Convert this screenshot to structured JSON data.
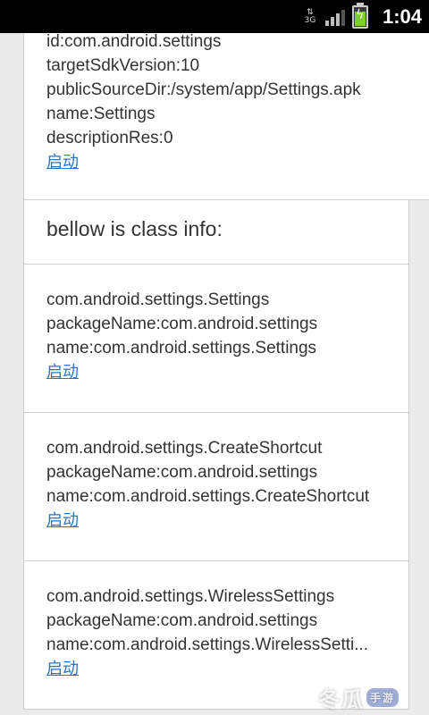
{
  "status_bar": {
    "network": "3G",
    "time": "1:04"
  },
  "app_info": {
    "lines": [
      "id:com.android.settings",
      "targetSdkVersion:10",
      "publicSourceDir:/system/app/Settings.apk",
      "name:Settings",
      "descriptionRes:0"
    ],
    "launch_label": "启动"
  },
  "class_header": "bellow is class info:",
  "classes": [
    {
      "class_name": "com.android.settings.Settings",
      "package_line": "packageName:com.android.settings",
      "name_line": "name:com.android.settings.Settings",
      "launch_label": "启动"
    },
    {
      "class_name": "com.android.settings.CreateShortcut",
      "package_line": "packageName:com.android.settings",
      "name_line": "name:com.android.settings.CreateShortcut",
      "launch_label": "启动"
    },
    {
      "class_name": "com.android.settings.WirelessSettings",
      "package_line": "packageName:com.android.settings",
      "name_line": "name:com.android.settings.WirelessSetti...",
      "launch_label": "启动"
    }
  ],
  "watermark": {
    "main": "冬瓜",
    "badge": "手游"
  }
}
